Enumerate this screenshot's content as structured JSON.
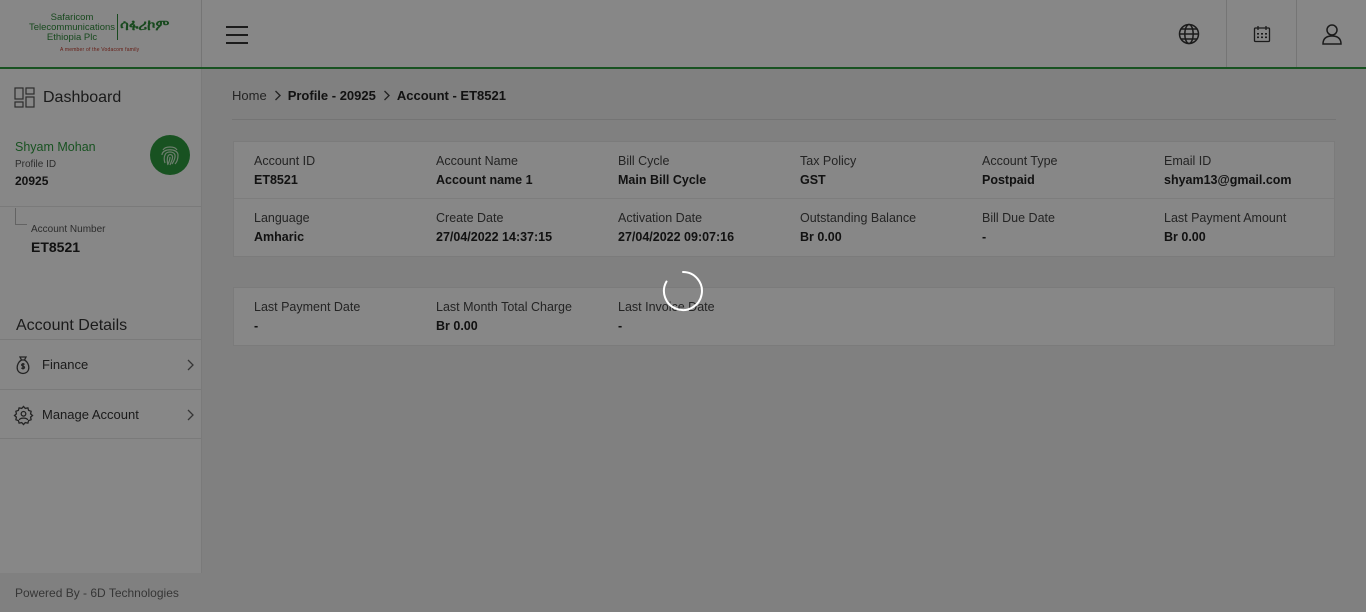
{
  "logo": {
    "line1": "Safaricom",
    "line2": "Telecommunications",
    "line3": "Ethiopia Plc",
    "amharic": "ሳፋሪኮም",
    "tagline": "A member of the Vodacom family"
  },
  "sidebar": {
    "dashboard_label": "Dashboard",
    "user_name": "Shyam Mohan",
    "profile_id_label": "Profile ID",
    "profile_id": "20925",
    "account_number_label": "Account Number",
    "account_number": "ET8521",
    "section_title": "Account Details",
    "menu": [
      {
        "label": "Finance",
        "icon": "money-bag-icon"
      },
      {
        "label": "Manage Account",
        "icon": "gear-user-icon"
      }
    ],
    "footer": "Powered By - 6D Technologies"
  },
  "breadcrumb": {
    "home": "Home",
    "profile": "Profile - 20925",
    "account": "Account - ET8521"
  },
  "details": {
    "row1": [
      {
        "label": "Account ID",
        "value": "ET8521"
      },
      {
        "label": "Account Name",
        "value": "Account name 1"
      },
      {
        "label": "Bill Cycle",
        "value": "Main Bill Cycle"
      },
      {
        "label": "Tax Policy",
        "value": "GST"
      },
      {
        "label": "Account Type",
        "value": "Postpaid"
      },
      {
        "label": "Email ID",
        "value": "shyam13@gmail.com"
      }
    ],
    "row2": [
      {
        "label": "Language",
        "value": "Amharic"
      },
      {
        "label": "Create Date",
        "value": "27/04/2022 14:37:15"
      },
      {
        "label": "Activation Date",
        "value": "27/04/2022 09:07:16"
      },
      {
        "label": "Outstanding Balance",
        "value": "Br 0.00"
      },
      {
        "label": "Bill Due Date",
        "value": "-"
      },
      {
        "label": "Last Payment Amount",
        "value": "Br 0.00"
      }
    ],
    "row3": [
      {
        "label": "Last Payment Date",
        "value": "-"
      },
      {
        "label": "Last Month Total Charge",
        "value": "Br 0.00"
      },
      {
        "label": "Last Invoice Date",
        "value": "-"
      }
    ]
  },
  "colors": {
    "brand_green": "#2e9b3f",
    "overlay": "rgba(0,0,0,0.47)"
  }
}
